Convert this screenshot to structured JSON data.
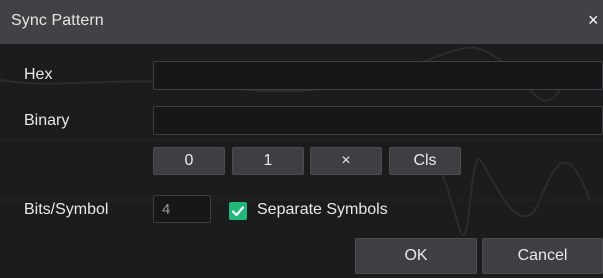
{
  "dialog": {
    "title": "Sync Pattern",
    "close_glyph": "×"
  },
  "form": {
    "hex_label": "Hex",
    "hex_value": "",
    "binary_label": "Binary",
    "binary_value": "",
    "bits_label": "Bits/Symbol",
    "bits_value": "4",
    "separate_label": "Separate Symbols",
    "separate_checked": true
  },
  "keypad": {
    "zero": "0",
    "one": "1",
    "x": "×",
    "cls": "Cls"
  },
  "actions": {
    "ok": "OK",
    "cancel": "Cancel"
  },
  "colors": {
    "accent": "#22b87a",
    "titlebar": "#404245",
    "background": "#1b1c1e"
  },
  "icons": {
    "close": "close-icon",
    "check": "check-icon"
  }
}
